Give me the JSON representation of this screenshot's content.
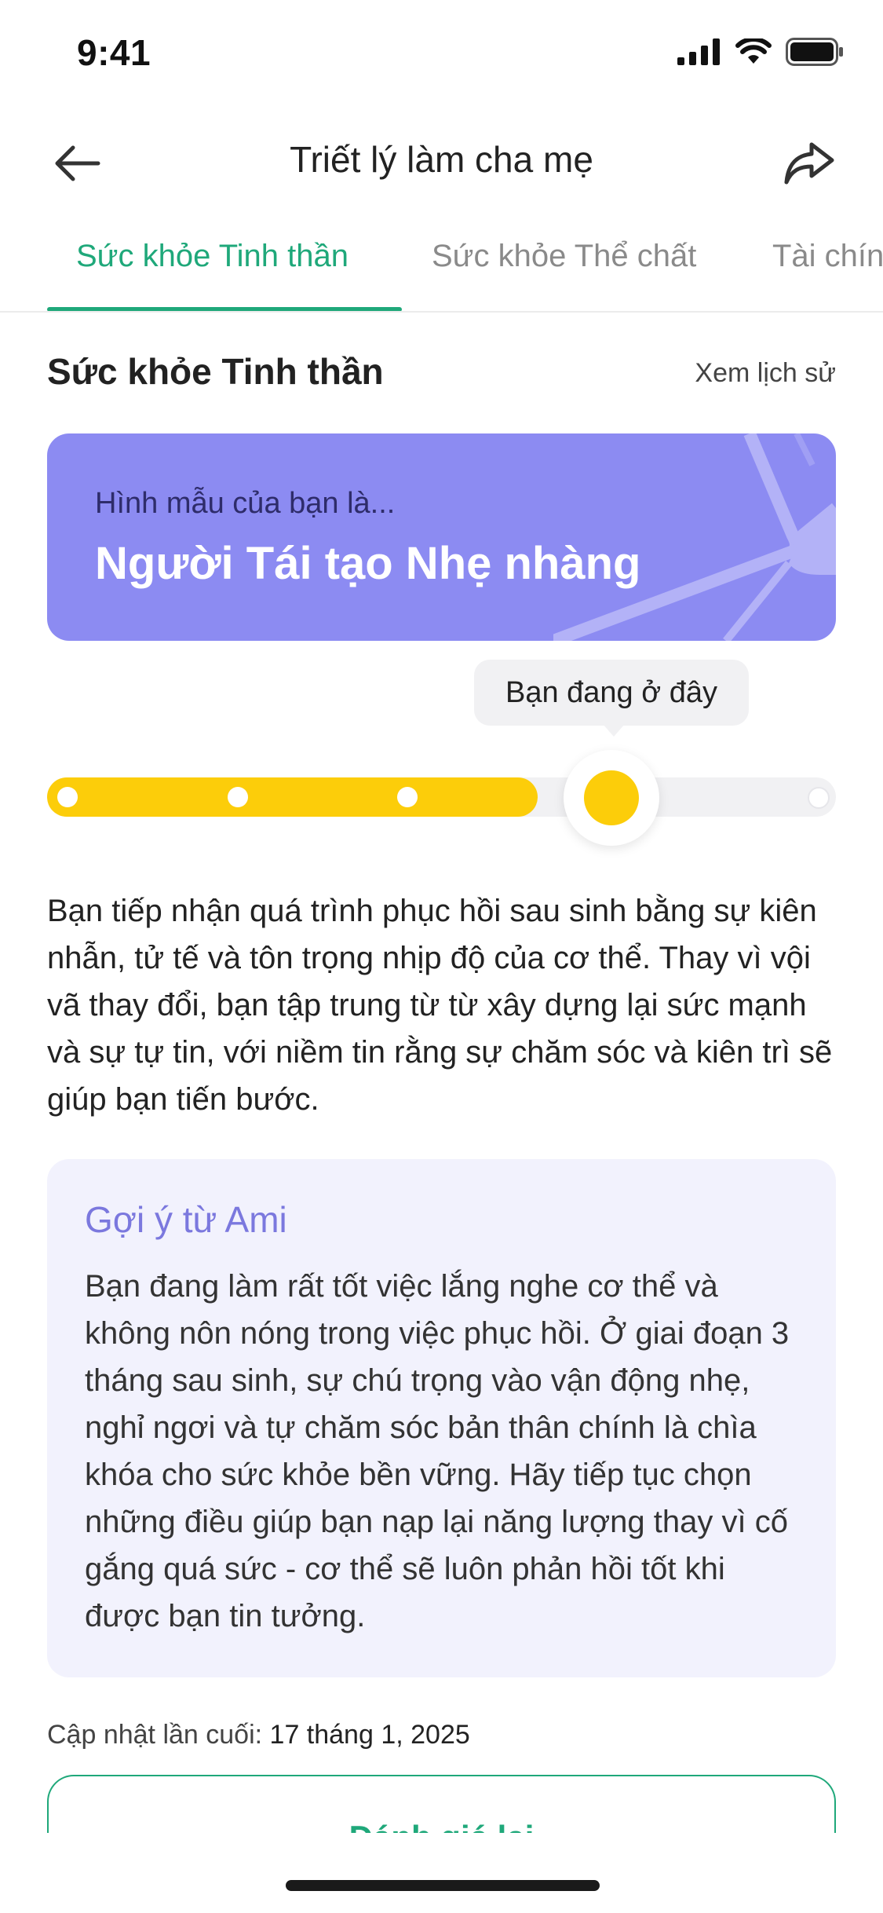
{
  "status_bar": {
    "time": "9:41"
  },
  "header": {
    "title": "Triết lý làm cha mẹ",
    "back_icon": "arrow-left-icon",
    "share_icon": "share-arrow-icon"
  },
  "tabs": [
    {
      "label": "Sức khỏe Tinh thần",
      "active": true
    },
    {
      "label": "Sức khỏe Thể chất",
      "active": false
    },
    {
      "label": "Tài chính",
      "active": false
    }
  ],
  "section": {
    "title": "Sức khỏe Tinh thần",
    "history_link": "Xem lịch sử"
  },
  "hero": {
    "subtitle": "Hình mẫu của bạn là...",
    "title": "Người Tái tạo Nhẹ nhàng",
    "color": "#8c8bf2"
  },
  "progress": {
    "tooltip": "Bạn đang ở đây",
    "level_fraction": 0.6,
    "stops": 6,
    "current_stop": 4,
    "fill_color": "#fccd0a"
  },
  "description": "Bạn tiếp nhận quá trình phục hồi sau sinh bằng sự kiên nhẫn, tử tế và tôn trọng nhịp độ của cơ thể. Thay vì vội vã thay đổi, bạn tập trung từ từ xây dựng lại sức mạnh và sự tự tin, với niềm tin rằng sự chăm sóc và kiên trì sẽ giúp bạn tiến bước.",
  "suggestion": {
    "title": "Gợi ý từ Ami",
    "body": "Bạn đang làm rất tốt việc lắng nghe cơ thể và không nôn nóng trong việc phục hồi. Ở giai đoạn 3 tháng sau sinh, sự chú trọng vào vận động nhẹ, nghỉ ngơi và tự chăm sóc bản thân chính là chìa khóa cho sức khỏe bền vững. Hãy tiếp tục chọn những điều giúp bạn nạp lại năng lượng thay vì cố gắng quá sức - cơ thể sẽ luôn phản hồi tốt khi được bạn tin tưởng."
  },
  "footer": {
    "updated_label": "Cập nhật lần cuối:",
    "updated_date": "17 tháng 1, 2025",
    "reassess_label": "Đánh giá lại"
  },
  "colors": {
    "accent": "#1fa87a",
    "hero": "#8c8bf2",
    "suggestion_title": "#7b78de",
    "progress": "#fccd0a"
  }
}
